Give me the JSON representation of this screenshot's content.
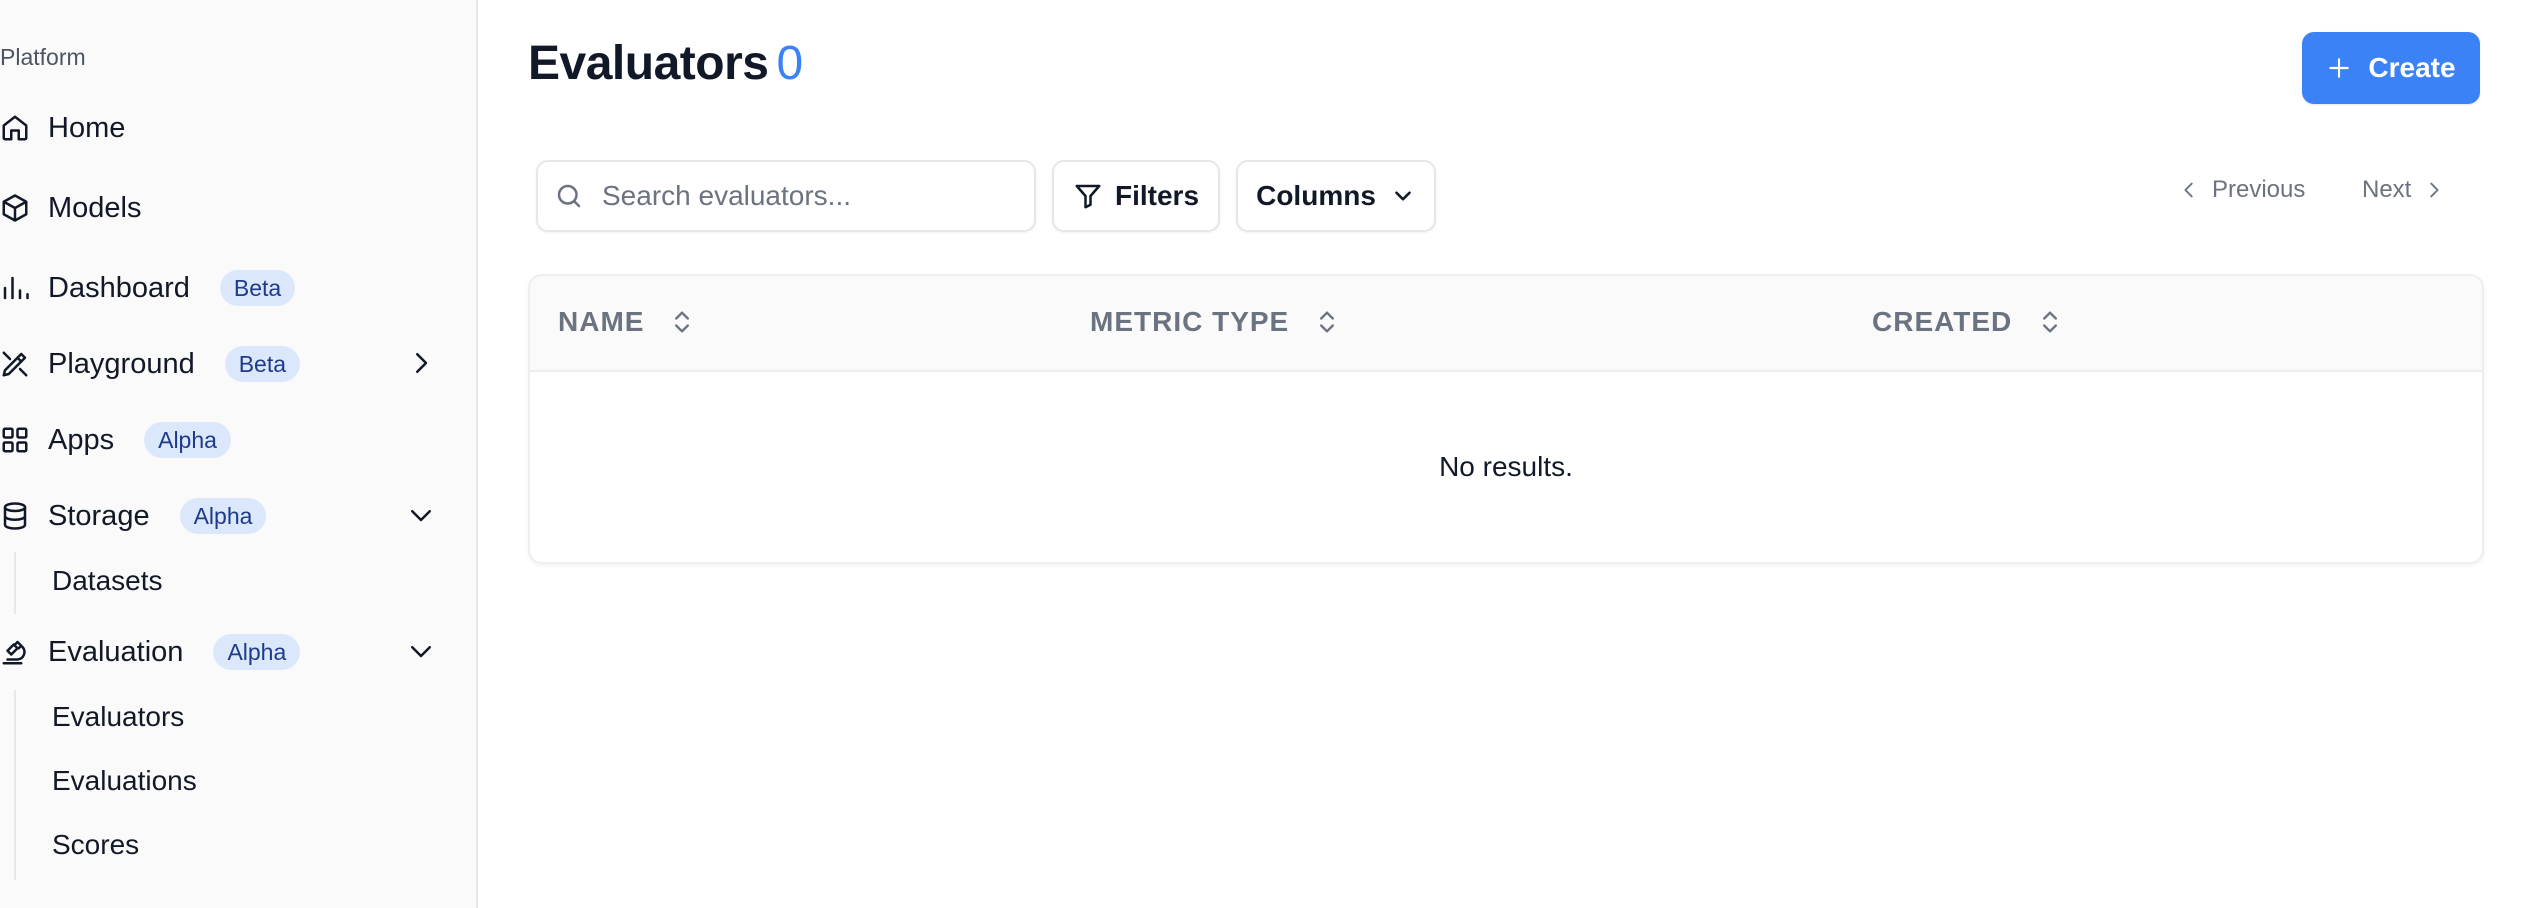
{
  "sidebar": {
    "section_label": "Platform",
    "items": [
      {
        "label": "Home",
        "icon": "home-icon"
      },
      {
        "label": "Models",
        "icon": "cube-icon"
      },
      {
        "label": "Dashboard",
        "icon": "bar-chart-icon",
        "badge": "Beta"
      },
      {
        "label": "Playground",
        "icon": "pen-tool-icon",
        "badge": "Beta",
        "chevron": "chevron-right-icon"
      },
      {
        "label": "Apps",
        "icon": "grid-icon",
        "badge": "Alpha"
      },
      {
        "label": "Storage",
        "icon": "database-icon",
        "badge": "Alpha",
        "chevron": "chevron-down-icon"
      },
      {
        "label": "Evaluation",
        "icon": "microscope-icon",
        "badge": "Alpha",
        "chevron": "chevron-down-icon"
      }
    ],
    "storage_children": [
      "Datasets"
    ],
    "evaluation_children": [
      "Evaluators",
      "Evaluations",
      "Scores"
    ]
  },
  "header": {
    "title": "Evaluators",
    "count": "0",
    "create_label": "Create"
  },
  "toolbar": {
    "search_placeholder": "Search evaluators...",
    "filters_label": "Filters",
    "columns_label": "Columns",
    "previous_label": "Previous",
    "next_label": "Next"
  },
  "table": {
    "columns": [
      "NAME",
      "METRIC TYPE",
      "CREATED"
    ],
    "empty_text": "No results."
  },
  "colors": {
    "accent": "#3b82f6",
    "badge_bg": "#dbe7fb",
    "badge_text": "#1e3a8a"
  }
}
